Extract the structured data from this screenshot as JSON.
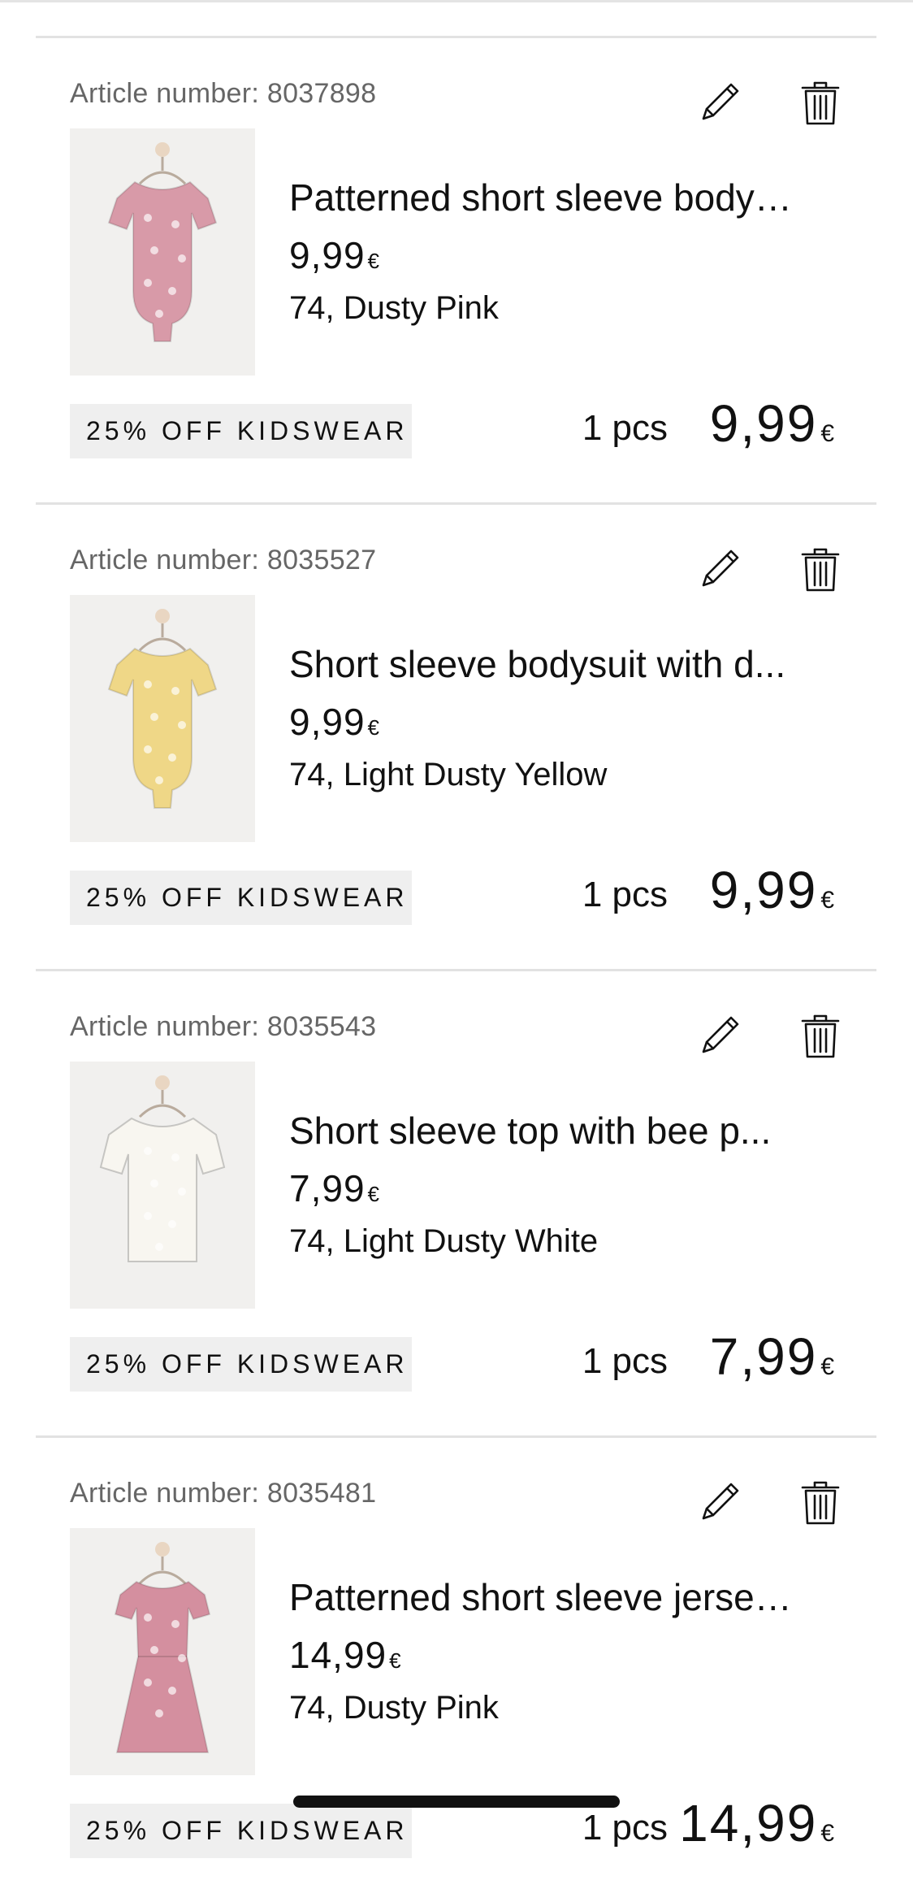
{
  "labels": {
    "article_prefix": "Article number:",
    "qty_suffix": "pcs"
  },
  "cart_items": [
    {
      "article_number": "Article number: 8037898",
      "name": "Patterned short sleeve bodysuit",
      "unit_price": "9,99",
      "currency": "€",
      "variant": "74, Dusty Pink",
      "promotion": "25% OFF KIDSWEAR",
      "quantity": "1 pcs",
      "line_total": "9,99",
      "garment_color": "#d89aa8",
      "print_icon": "daisy-print-icon"
    },
    {
      "article_number": "Article number: 8035527",
      "name": "Short sleeve bodysuit with d...",
      "unit_price": "9,99",
      "currency": "€",
      "variant": "74, Light Dusty Yellow",
      "promotion": "25% OFF KIDSWEAR",
      "quantity": "1 pcs",
      "line_total": "9,99",
      "garment_color": "#efd787",
      "print_icon": "duck-print-icon"
    },
    {
      "article_number": "Article number: 8035543",
      "name": "Short sleeve top with bee p...",
      "unit_price": "7,99",
      "currency": "€",
      "variant": "74, Light Dusty White",
      "promotion": "25% OFF KIDSWEAR",
      "quantity": "1 pcs",
      "line_total": "7,99",
      "garment_color": "#f8f6f0",
      "print_icon": "bee-print-icon"
    },
    {
      "article_number": "Article number: 8035481",
      "name": "Patterned short sleeve jersey...",
      "unit_price": "14,99",
      "currency": "€",
      "variant": "74, Dusty Pink",
      "promotion": "25% OFF KIDSWEAR",
      "quantity": "1 pcs",
      "line_total": "14,99",
      "garment_color": "#d48f9f",
      "print_icon": "daisy-print-icon"
    }
  ],
  "icons": {
    "edit": "pencil-icon",
    "delete": "trash-icon"
  },
  "colors": {
    "text": "#111111",
    "muted": "#666666",
    "badge_bg": "#efefef",
    "divider": "#e2e2e2"
  }
}
